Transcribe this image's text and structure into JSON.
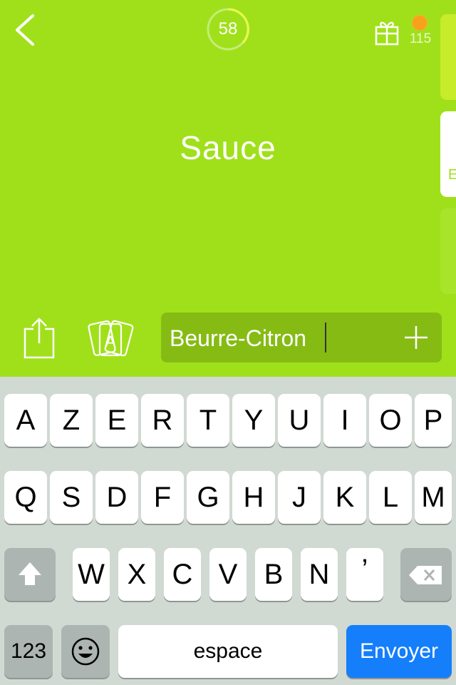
{
  "header": {
    "level": "58",
    "coins": "115"
  },
  "card": {
    "word": "Sauce",
    "peek_letter": "E"
  },
  "input": {
    "value": "Beurre-Citron",
    "placeholder": ""
  },
  "keyboard": {
    "row1": [
      "A",
      "Z",
      "E",
      "R",
      "T",
      "Y",
      "U",
      "I",
      "O",
      "P"
    ],
    "row2": [
      "Q",
      "S",
      "D",
      "F",
      "G",
      "H",
      "J",
      "K",
      "L",
      "M"
    ],
    "row3": [
      "W",
      "X",
      "C",
      "V",
      "B",
      "N",
      "’"
    ],
    "numbers_label": "123",
    "space_label": "espace",
    "send_label": "Envoyer"
  },
  "colors": {
    "accent_green": "#a0e01a",
    "send_blue": "#147efb",
    "coin_orange": "#f7a21a"
  },
  "icons": [
    "back-chevron-icon",
    "gift-icon",
    "coin-icon",
    "share-icon",
    "cards-icon",
    "plus-icon",
    "shift-icon",
    "delete-icon",
    "emoji-icon"
  ]
}
